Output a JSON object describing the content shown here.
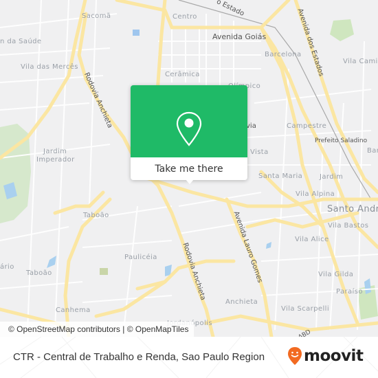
{
  "map": {
    "labels": {
      "sacoma": "Sacomã",
      "centro": "Centro",
      "estado": "o Estado",
      "avenida_goias": "Avenida Goiás",
      "avenida_dos_estados": "Avenida dos Estados",
      "barcelona": "Barcelona",
      "vila_camilopolis": "Vila Cami",
      "jardim_da_saude": "n da Saúde",
      "vila_das_merces": "Vila das Mercês",
      "ceramica": "Cerâmica",
      "olimpico": "Olímpico",
      "rodovia_anchieta_top": "Rodovia Anchieta",
      "jardim_imperador_1": "Jardim",
      "jardim_imperador_2": "Imperador",
      "campestre": "Campestre",
      "prefeito_saladino": "Prefeito Saladino",
      "bairro_right": "Bar",
      "via": "via",
      "vista": "Vista",
      "santa_maria": "Santa Maria",
      "jardim": "Jardim",
      "vila_alpina": "Vila Alpina",
      "santo_andre": "Santo Andr",
      "vila_bastos": "Vila Bastos",
      "taboao_top": "Taboão",
      "taboao_left": "Taboão",
      "ario": "ário",
      "paulliceia": "Paulicéia",
      "avenida_lauro_gomes": "Avenida Lauro Gomes",
      "rodovia_anchieta_bottom": "Rodovia Anchieta",
      "vila_alice": "Vila Alice",
      "vila_gilda": "Vila Gilda",
      "paraiso": "Paraíso",
      "anchieta": "Anchieta",
      "vila_scarpelli": "Vila Scarpelli",
      "canhema": "Canhema",
      "jordanopolis": "Jordanópolis",
      "abd": "ABD"
    },
    "popup": {
      "icon": "map-pin-icon",
      "cta_label": "Take me there",
      "color": "#1fba67"
    },
    "attribution": "© OpenStreetMap contributors | © OpenMapTiles"
  },
  "footer": {
    "title": "CTR - Central de Trabalho e Renda, Sao Paulo Region",
    "brand": "moovit",
    "brand_icon": "moovit-smiley-pin-icon",
    "brand_color": "#f26a21"
  }
}
